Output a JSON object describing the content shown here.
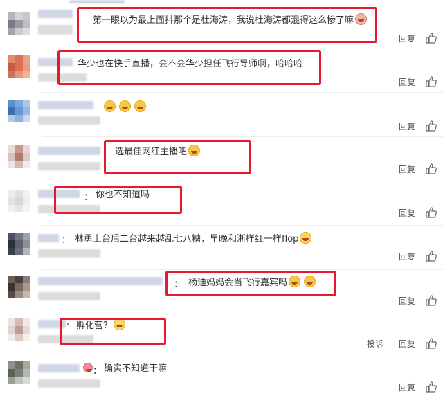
{
  "comments": [
    {
      "text": "第一眼以为最上面排那个是杜海涛，我说杜海涛都混得这么惨了嘛",
      "emoji": [
        "sad"
      ],
      "reply": "回复",
      "report": ""
    },
    {
      "text": "华少也在快手直播，会不会华少担任飞行导师啊，哈哈哈",
      "emoji": [],
      "reply": "回复",
      "report": ""
    },
    {
      "text": "",
      "emoji": [
        "laugh",
        "laugh",
        "laugh"
      ],
      "reply": "回复",
      "report": ""
    },
    {
      "text": "选最佳网红主播吧",
      "emoji": [
        "laugh"
      ],
      "reply": "回复",
      "report": ""
    },
    {
      "text": "你也不知道吗",
      "emoji": [],
      "reply": "回复",
      "report": ""
    },
    {
      "text": "林勇上台后二台越来越乱七八糟，早晚和浙样红一样flop",
      "emoji": [
        "roll"
      ],
      "reply": "回复",
      "report": ""
    },
    {
      "text": "杨迪妈妈会当飞行嘉宾吗",
      "emoji": [
        "laugh",
        "laugh"
      ],
      "reply": "回复",
      "report": ""
    },
    {
      "text": "孵化营？",
      "emoji": [
        "smile"
      ],
      "reply": "回复",
      "report": "投诉"
    },
    {
      "text": "确实不知道干嘛",
      "emoji": [],
      "reply": "回复",
      "report": ""
    }
  ],
  "colors": {
    "highlight": "#e8192c",
    "name": "#cfd6e6",
    "text": "#333333"
  },
  "icons": [
    "thumbs-up-icon"
  ]
}
